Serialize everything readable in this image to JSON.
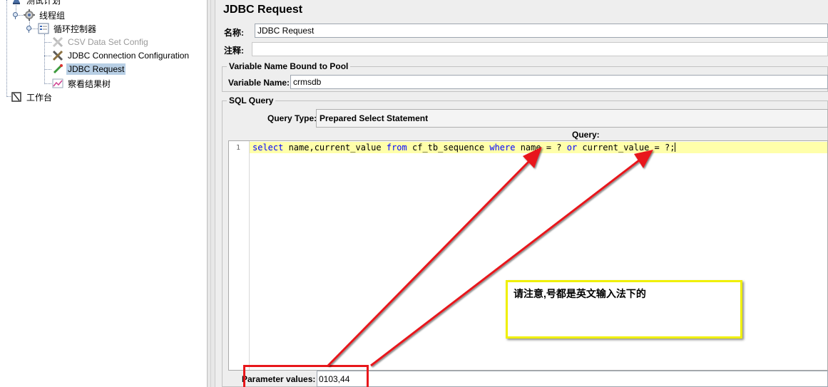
{
  "tree": {
    "root_label": "测试计划",
    "thread_group": "线程组",
    "loop_controller": "循环控制器",
    "csv_config": "CSV Data Set Config",
    "jdbc_connection": "JDBC Connection Configuration",
    "jdbc_request": "JDBC Request",
    "results_tree": "察看结果树",
    "workbench": "工作台"
  },
  "panel": {
    "title": "JDBC Request",
    "name_label": "名称:",
    "name_value": "JDBC Request",
    "comment_label": "注释:",
    "comment_value": "",
    "pool_group_title": "Variable Name Bound to Pool",
    "variable_name_label": "Variable Name:",
    "variable_name_value": "crmsdb",
    "sql_group_title": "SQL Query",
    "query_type_label": "Query Type:",
    "query_type_value": "Prepared Select Statement",
    "query_label": "Query:",
    "line_number": "1",
    "code": {
      "k1": "select",
      "t1": " name,current_value ",
      "k2": "from",
      "t2": " cf_tb_sequence ",
      "k3": "where",
      "t3": " name = ? ",
      "k4": "or",
      "t4": " current_value = ?;"
    },
    "parameter_values_label": "Parameter values:",
    "parameter_values_value": "0103,44"
  },
  "annotation": {
    "note": "请注意,号都是英文输入法下的",
    "arrow_color": "#e8171b",
    "note_border_color": "#f0f000"
  },
  "colors": {
    "keyword": "#0000ff",
    "current_line": "#ffffaa",
    "selection": "#b8cfe5"
  }
}
